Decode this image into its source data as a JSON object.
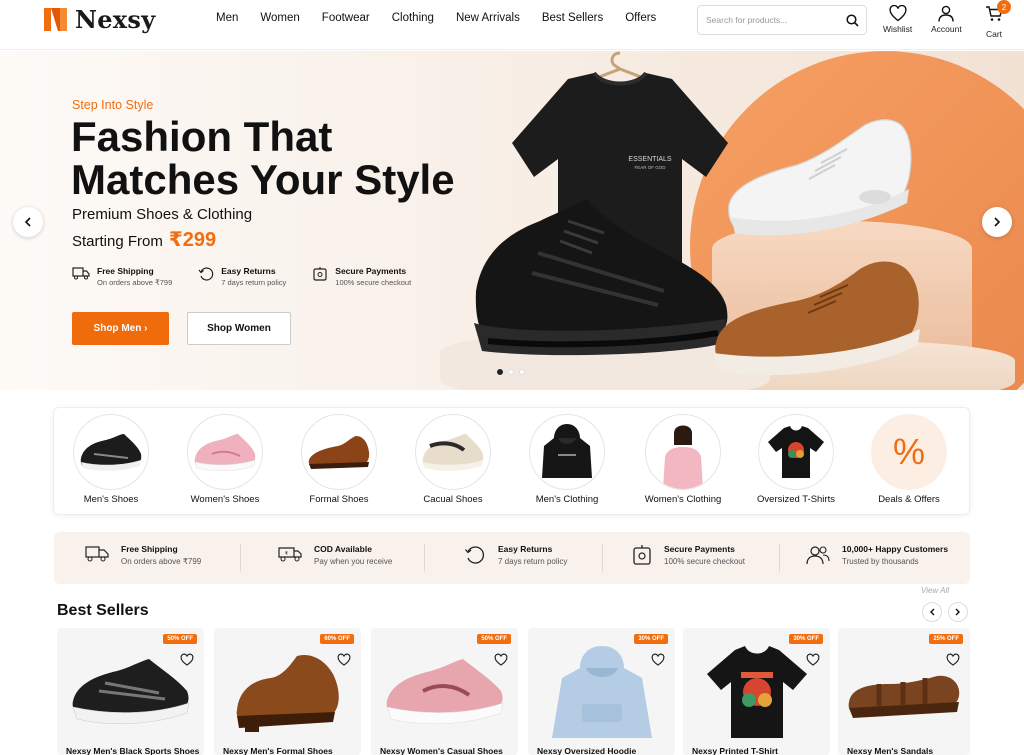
{
  "header": {
    "brand": "Nexsy",
    "nav": [
      "Men",
      "Women",
      "Footwear",
      "Clothing",
      "New Arrivals",
      "Best Sellers",
      "Offers"
    ],
    "search_placeholder": "Search for products...",
    "wishlist_label": "Wishlist",
    "account_label": "Account",
    "cart_label": "Cart",
    "cart_count": "2"
  },
  "hero": {
    "eyebrow": "Step Into Style",
    "title_line1": "Fashion That",
    "title_line2": "Matches Your Style",
    "subtitle": "Premium Shoes & Clothing",
    "starting_from": "Starting From",
    "price": "₹299",
    "perks": [
      {
        "title": "Free Shipping",
        "desc": "On orders above ₹799",
        "icon": "truck-icon"
      },
      {
        "title": "Easy Returns",
        "desc": "7 days return policy",
        "icon": "returns-icon"
      },
      {
        "title": "Secure Payments",
        "desc": "100% secure checkout",
        "icon": "secure-payment-icon"
      }
    ],
    "shop_men": "Shop Men ›",
    "shop_women": "Shop Women",
    "tshirt_print_1": "ESSENTIALS",
    "tshirt_print_2": "FEAR OF GOD",
    "slide_count": 3,
    "active_slide": 1
  },
  "categories": [
    {
      "label": "Men's Shoes"
    },
    {
      "label": "Women's Shoes"
    },
    {
      "label": "Formal Shoes"
    },
    {
      "label": "Cacual Shoes"
    },
    {
      "label": "Men's Clothing"
    },
    {
      "label": "Women's Clothing"
    },
    {
      "label": "Oversized T-Shirts"
    },
    {
      "label": "Deals & Offers",
      "symbol": "%"
    }
  ],
  "features": [
    {
      "title": "Free Shipping",
      "desc": "On orders above ₹799",
      "icon": "truck-icon"
    },
    {
      "title": "COD Available",
      "desc": "Pay when you receive",
      "icon": "cod-van-icon"
    },
    {
      "title": "Easy Returns",
      "desc": "7 days return policy",
      "icon": "returns-icon"
    },
    {
      "title": "Secure Payments",
      "desc": "100% secure checkout",
      "icon": "secure-payment-icon"
    },
    {
      "title": "10,000+ Happy Customers",
      "desc": "Trusted by thousands",
      "icon": "customers-icon"
    }
  ],
  "best_sellers": {
    "title": "Best Sellers",
    "view_all": "View All",
    "products": [
      {
        "name": "Nexsy Men's Black Sports Shoes",
        "discount": "50% OFF"
      },
      {
        "name": "Nexsy Men's Formal Shoes",
        "discount": "60% OFF"
      },
      {
        "name": "Nexsy Women's Casual Shoes",
        "discount": "50% OFF"
      },
      {
        "name": "Nexsy Oversized Hoodie",
        "discount": "30% OFF"
      },
      {
        "name": "Nexsy Printed T-Shirt",
        "discount": "30% OFF"
      },
      {
        "name": "Nexsy Men's Sandals",
        "discount": "25% OFF"
      }
    ]
  },
  "colors": {
    "accent": "#f06e10",
    "dark": "#111111"
  }
}
